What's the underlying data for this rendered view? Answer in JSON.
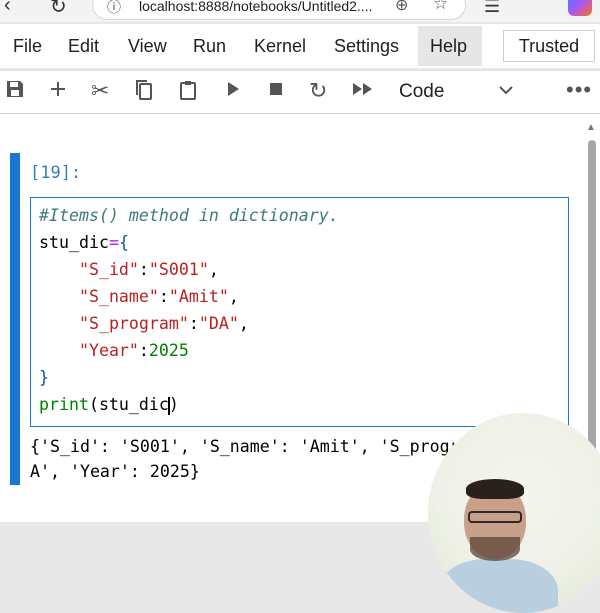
{
  "browser": {
    "url": "localhost:8888/notebooks/Untitled2....",
    "icons": [
      "refresh-icon",
      "site-info-icon",
      "zoom-icon",
      "bookmark-star-icon",
      "favorites-icon",
      "copilot-icon"
    ]
  },
  "menu": {
    "items": [
      "File",
      "Edit",
      "View",
      "Run",
      "Kernel",
      "Settings",
      "Help"
    ],
    "trusted": "Trusted"
  },
  "toolbar": {
    "icons": [
      "save-icon",
      "add-cell-icon",
      "cut-icon",
      "copy-icon",
      "paste-icon",
      "run-icon",
      "stop-icon",
      "restart-icon",
      "run-all-icon",
      "more-icon"
    ],
    "cell_type": "Code"
  },
  "cell": {
    "prompt": "[19]:",
    "code": [
      "#Items() method in dictionary.",
      "stu_dic={",
      "    \"S_id\":\"S001\",",
      "    \"S_name\":\"Amit\",",
      "    \"S_program\":\"DA\",",
      "    \"Year\":2025",
      "}",
      "print(stu_dic)"
    ],
    "output": [
      "{'S_id': 'S001', 'S_name': 'Amit', 'S_program': 'D",
      "A', 'Year': 2025}"
    ]
  },
  "colors": {
    "accent": "#1976d2",
    "prompt": "#307fc1",
    "comment": "#3d7b7b",
    "string": "#ba2121",
    "number": "#008000"
  }
}
